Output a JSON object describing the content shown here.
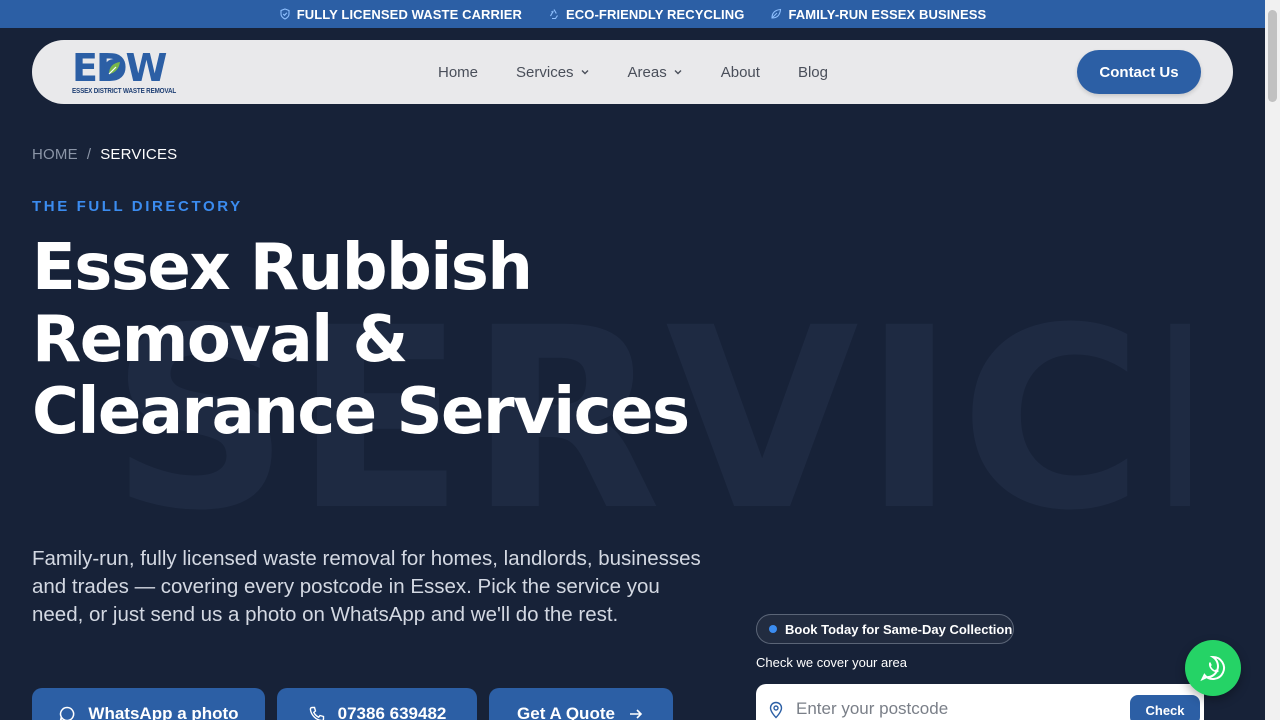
{
  "topbar": {
    "items": [
      {
        "label": "FULLY LICENSED WASTE CARRIER",
        "icon": "shield-check-icon"
      },
      {
        "label": "ECO-FRIENDLY RECYCLING",
        "icon": "recycle-icon"
      },
      {
        "label": "FAMILY-RUN ESSEX BUSINESS",
        "icon": "leaf-icon"
      }
    ]
  },
  "logo": {
    "mark": "EDW",
    "tagline": "ESSEX DISTRICT WASTE REMOVAL"
  },
  "nav": {
    "items": [
      {
        "label": "Home"
      },
      {
        "label": "Services"
      },
      {
        "label": "Areas"
      },
      {
        "label": "About"
      },
      {
        "label": "Blog"
      }
    ],
    "contact_label": "Contact Us"
  },
  "breadcrumb": {
    "home": "HOME",
    "separator": "/",
    "current": "SERVICES"
  },
  "hero": {
    "eyebrow": "THE FULL DIRECTORY",
    "watermark": "SERVICES",
    "headline": "Essex Rubbish Removal & Clearance Services",
    "lead": "Family-run, fully licensed waste removal for homes, landlords, businesses and trades — covering every postcode in Essex. Pick the service you need, or just send us a photo on WhatsApp and we'll do the rest."
  },
  "ctas": {
    "whatsapp": "WhatsApp a photo",
    "phone": "07386 639482",
    "quote": "Get A Quote"
  },
  "booking": {
    "badge": "Book Today for Same-Day Collection",
    "cover_label": "Check we cover your area",
    "postcode_placeholder": "Enter your postcode",
    "check_label": "Check"
  },
  "colors": {
    "background": "#172238",
    "brand_blue": "#2c5fa5",
    "accent_blue": "#3b8cf0",
    "whatsapp_green": "#25d366"
  }
}
